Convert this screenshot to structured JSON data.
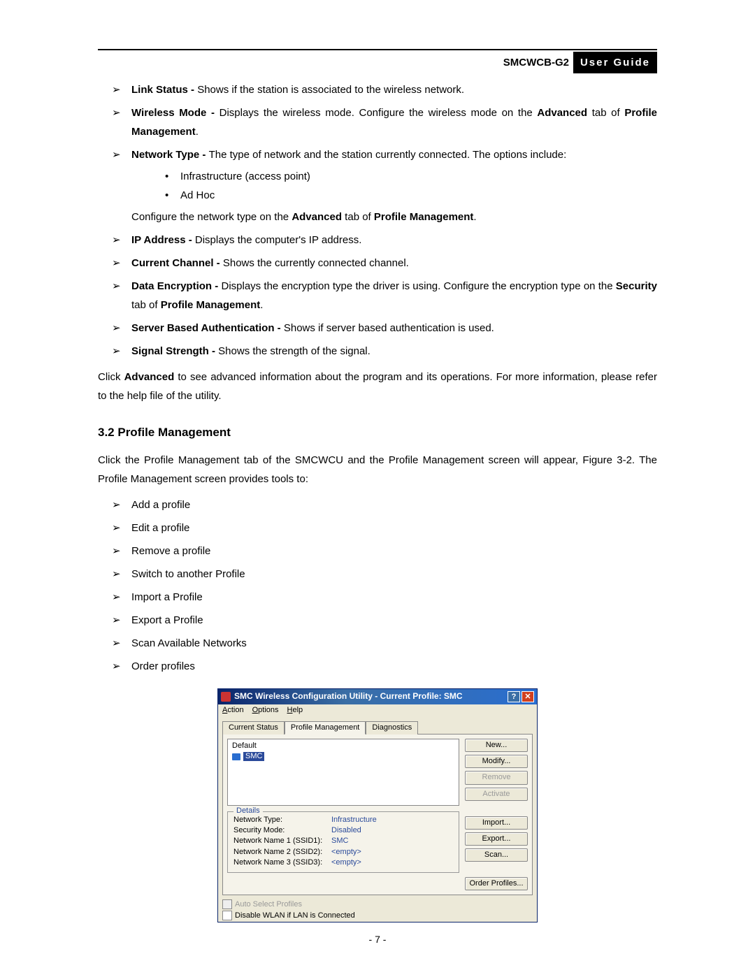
{
  "header": {
    "model": "SMCWCB-G2",
    "guide": "User  Guide"
  },
  "list1": {
    "link_status_b": "Link Status - ",
    "link_status": "Shows if the station is associated to the wireless network.",
    "wireless_mode_b": "Wireless  Mode  - ",
    "wireless_mode_1": "Displays  the  wireless  mode.  Configure  the  wireless  mode  on  the ",
    "wireless_mode_adv": "Advanced",
    "wireless_mode_2": " tab of ",
    "wireless_mode_pm": "Profile Management",
    "wireless_mode_3": ".",
    "network_type_b": "Network  Type  - ",
    "network_type_1": "The  type  of  network  and  the  station  currently  connected.  The  options include:",
    "nt_sub1": "Infrastructure (access point)",
    "nt_sub2": "Ad Hoc",
    "nt_after_1": "Configure the network type on the ",
    "nt_after_adv": "Advanced",
    "nt_after_2": " tab of ",
    "nt_after_pm": "Profile Management",
    "nt_after_3": ".",
    "ip_b": "IP Address - ",
    "ip": "Displays the computer's IP address.",
    "cc_b": "Current Channel - ",
    "cc": "Shows the currently connected channel.",
    "de_b": "Data  Encryption  - ",
    "de_1": "Displays  the  encryption  type  the  driver  is  using.  Configure  the encryption type on the ",
    "de_sec": "Security",
    "de_2": " tab of ",
    "de_pm": "Profile Management",
    "de_3": ".",
    "sba_b": "Server Based Authentication - ",
    "sba": "Shows if server based authentication is used.",
    "ss_b": "Signal Strength - ",
    "ss": "Shows the strength of the signal."
  },
  "para1_1": "Click ",
  "para1_adv": "Advanced",
  "para1_2": " to see advanced information about the program and its operations. For more information, please refer to the help file of the utility.",
  "section_heading": "3.2   Profile Management",
  "para2": "Click  the  Profile  Management  tab  of  the  SMCWCU  and  the  Profile  Management  screen  will appear, Figure 3-2. The Profile Management screen provides tools to:",
  "list2": {
    "i1": "Add a profile",
    "i2": "Edit a profile",
    "i3": "Remove a profile",
    "i4": "Switch to another Profile",
    "i5": "Import a Profile",
    "i6": "Export a Profile",
    "i7": "Scan Available Networks",
    "i8": "Order profiles"
  },
  "app": {
    "title": "SMC Wireless Configuration Utility - Current Profile: SMC",
    "help_btn": "?",
    "close_btn": "✕",
    "menu": {
      "action": "Action",
      "options": "Options",
      "help": "Help"
    },
    "tabs": {
      "t1": "Current Status",
      "t2": "Profile Management",
      "t3": "Diagnostics"
    },
    "profiles": {
      "p1": "Default",
      "p2": "SMC"
    },
    "details": {
      "legend": "Details",
      "r1k": "Network Type:",
      "r1v": "Infrastructure",
      "r2k": "Security Mode:",
      "r2v": "Disabled",
      "r3k": "Network Name 1 (SSID1):",
      "r3v": "SMC",
      "r4k": "Network Name 2 (SSID2):",
      "r4v": "<empty>",
      "r5k": "Network Name 3 (SSID3):",
      "r5v": "<empty>"
    },
    "buttons": {
      "new": "New...",
      "modify": "Modify...",
      "remove": "Remove",
      "activate": "Activate",
      "import": "Import...",
      "export": "Export...",
      "scan": "Scan...",
      "order": "Order Profiles..."
    },
    "chk1": "Auto Select Profiles",
    "chk2": "Disable WLAN if LAN is Connected"
  },
  "page_number": "- 7 -"
}
